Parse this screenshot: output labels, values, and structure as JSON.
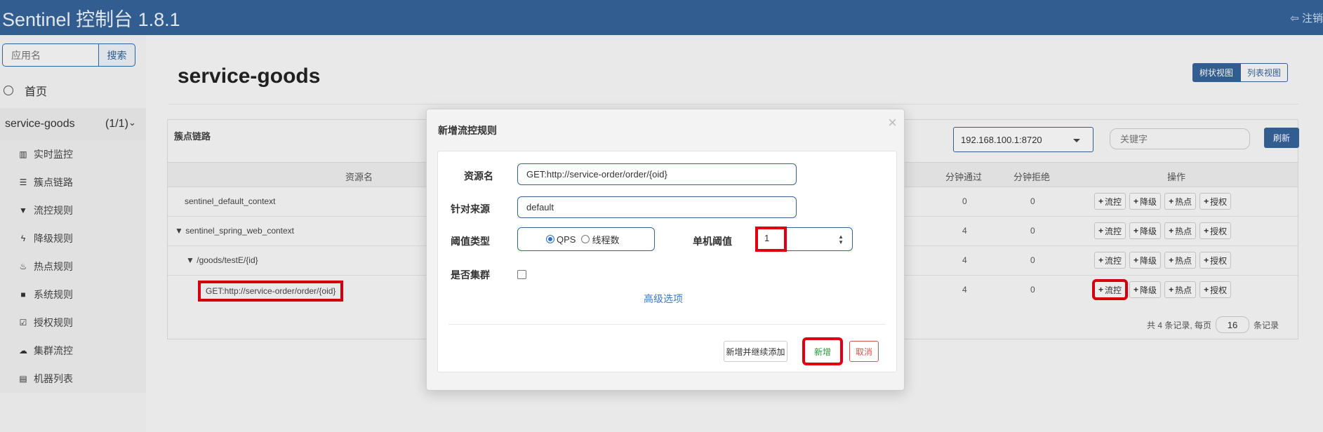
{
  "header": {
    "brand": "Sentinel 控制台 1.8.1",
    "logout_label": "注销"
  },
  "sidebar": {
    "search_placeholder": "应用名",
    "search_button": "搜索",
    "home_label": "首页",
    "app_name": "service-goods",
    "app_count": "(1/1)",
    "menu": [
      {
        "label": "实时监控",
        "icon": "bar-chart-icon"
      },
      {
        "label": "簇点链路",
        "icon": "list-icon"
      },
      {
        "label": "流控规则",
        "icon": "filter-icon"
      },
      {
        "label": "降级规则",
        "icon": "flash-icon"
      },
      {
        "label": "热点规则",
        "icon": "fire-icon"
      },
      {
        "label": "系统规则",
        "icon": "lock-icon"
      },
      {
        "label": "授权规则",
        "icon": "check-icon"
      },
      {
        "label": "集群流控",
        "icon": "cloud-icon"
      },
      {
        "label": "机器列表",
        "icon": "th-list-icon"
      }
    ]
  },
  "main": {
    "title": "service-goods",
    "view_tree": "树状视图",
    "view_list": "列表视图",
    "panel_title": "簇点链路",
    "machine_select": "192.168.100.1:8720",
    "keyword_placeholder": "关键字",
    "refresh_button": "刷新",
    "columns": {
      "resource": "资源名",
      "pass": "分钟通过",
      "block": "分钟拒绝",
      "ops": "操作"
    },
    "rows": [
      {
        "name": "sentinel_default_context",
        "pass": "0",
        "block": "0"
      },
      {
        "name": "sentinel_spring_web_context",
        "pass": "4",
        "block": "0"
      },
      {
        "name": "/goods/testE/{id}",
        "pass": "4",
        "block": "0"
      },
      {
        "name": "GET:http://service-order/order/{oid}",
        "pass": "4",
        "block": "0"
      }
    ],
    "row_toggle": "▼",
    "op_flow": "流控",
    "op_degrade": "降级",
    "op_hot": "热点",
    "op_auth": "授权",
    "pager_total": "共 4 条记录, 每页",
    "pager_size": "16",
    "pager_suffix": "条记录"
  },
  "modal": {
    "title": "新增流控规则",
    "close": "×",
    "resource_label": "资源名",
    "resource_value": "GET:http://service-order/order/{oid}",
    "origin_label": "针对来源",
    "origin_value": "default",
    "grade_label": "阈值类型",
    "grade_qps": "QPS",
    "grade_threads": "线程数",
    "threshold_label": "单机阈值",
    "threshold_value": "1",
    "cluster_label": "是否集群",
    "advanced_link": "高级选项",
    "btn_add_continue": "新增并继续添加",
    "btn_add": "新增",
    "btn_cancel": "取消"
  },
  "colors": {
    "brand": "#356399",
    "highlight": "#e0000f"
  }
}
